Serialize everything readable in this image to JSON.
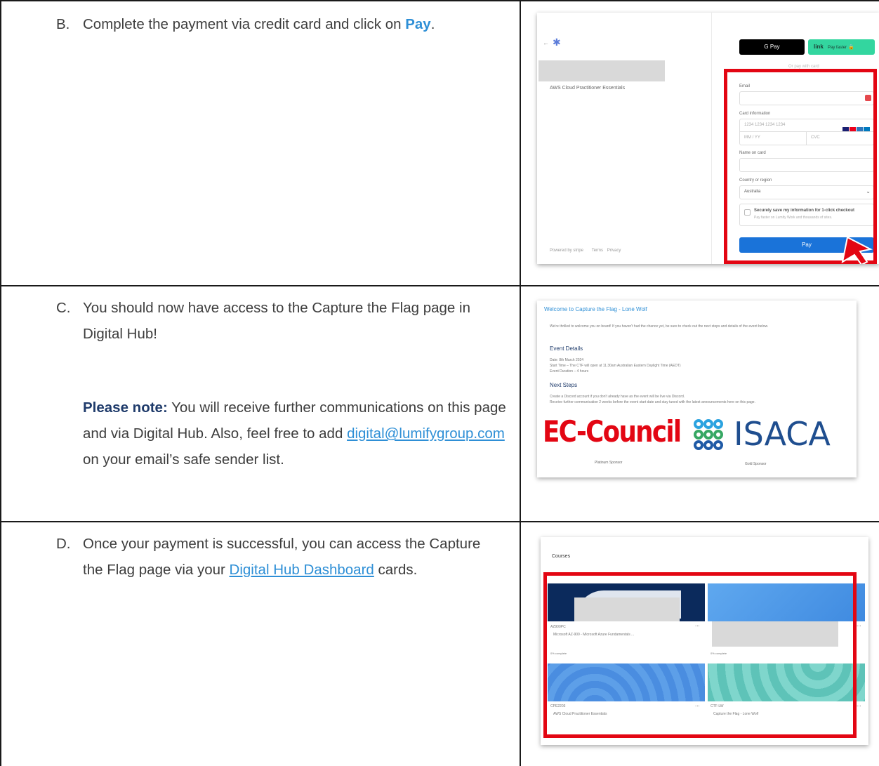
{
  "rows": [
    {
      "letter": "B.",
      "text_before": "Complete the payment via credit card and click on ",
      "highlight": "Pay",
      "text_after": "."
    },
    {
      "letter": "C.",
      "text": "You should now have access to the Capture the Flag page in Digital Hub!",
      "note_label": "Please note:",
      "note_text": " You will receive further communications on this page and via Digital Hub. Also, feel free to add ",
      "note_link": "digital@lumifygroup.com",
      "note_after": " on your email’s safe sender list."
    },
    {
      "letter": "D.",
      "text_before": "Once your payment is successful, you can access the Capture the Flag page via your ",
      "link": "Digital Hub Dashboard",
      "text_after": " cards."
    }
  ],
  "checkout": {
    "back_arrow": "←",
    "product": "AWS Cloud Practitioner Essentials",
    "gpay_label": "G Pay",
    "link_label": "link",
    "link_sub": "Pay faster",
    "or_label": "Or pay with card",
    "email_label": "Email",
    "card_label": "Card information",
    "card_placeholder": "1234 1234 1234 1234",
    "expiry_placeholder": "MM / YY",
    "cvc_placeholder": "CVC",
    "name_label": "Name on card",
    "country_label": "Country or region",
    "country_value": "Australia",
    "save_label": "Securely save my information for 1-click checkout",
    "save_sub": "Pay faster on Lumify Work and thousands of sites.",
    "pay_label": "Pay",
    "powered": "Powered by stripe",
    "terms": "Terms",
    "privacy": "Privacy"
  },
  "ctf": {
    "title": "Welcome to Capture the Flag - Lone Wolf",
    "intro": "We're thrilled to welcome you on board! If you haven't had the chance yet, be sure to check out the next steps and details of the event below.",
    "details_heading": "Event Details",
    "date_line": "Date: 8th March 2024",
    "start_line": "Start Time – The CTF will open at 11.30am Australian Eastern Daylight Time (AEDT)",
    "duration_line": "Event Duration – 4 hours",
    "next_heading": "Next Steps",
    "step1": "Create a Discord account if you don't already have as the event will be live via Discord.",
    "step2": "Receive further communication 2 weeks before the event start date and stay tuned with the latest announcements here on this page.",
    "sponsor1": "EC-Council",
    "sponsor1_tier": "Platinum Sponsor",
    "sponsor2": "ISACA",
    "sponsor2_tier": "Gold Sponsor"
  },
  "dashboard": {
    "heading": "Courses",
    "cards": [
      {
        "code": "AZ900PC",
        "name": "Microsoft AZ-900 - Microsoft Azure Fundamentals ...",
        "progress": "0% complete"
      },
      {
        "code": "",
        "name": "",
        "progress": "0% complete"
      },
      {
        "code": "CPE2203",
        "name": "AWS Cloud Practitioner Essentials",
        "progress": ""
      },
      {
        "code": "CTF-LW",
        "name": "Capture the Flag - Lone Wolf",
        "progress": ""
      }
    ],
    "more": "..."
  },
  "colors": {
    "accent_blue": "#2e8fd6",
    "navy": "#1f3b6b",
    "red_highlight": "#e30613",
    "pay_button": "#1a73d9",
    "link_green": "#33d69f"
  }
}
